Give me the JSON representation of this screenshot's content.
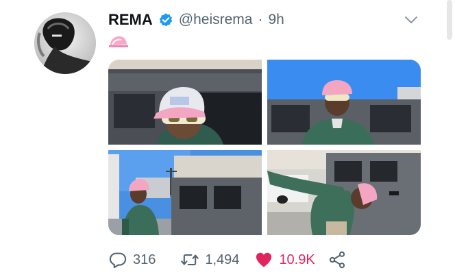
{
  "tweet": {
    "author_name": "REMA",
    "handle": "@heisrema",
    "separator": "·",
    "time": "9h",
    "verified": true,
    "caption_icon": "pink-trucker-cap-emoji",
    "menu_icon": "chevron-down-icon"
  },
  "media": {
    "images": [
      {
        "name": "photo-1",
        "subject": "person in pink trucker cap and yellow goggles leaning on dark jeep"
      },
      {
        "name": "photo-2",
        "subject": "person in pink cap and green hoodie in front of jeep"
      },
      {
        "name": "photo-3",
        "subject": "person in green hoodie standing next to grey jeep"
      },
      {
        "name": "photo-4",
        "subject": "person reaching out by grey jeep"
      }
    ]
  },
  "actions": {
    "reply_count": "316",
    "retweet_count": "1,494",
    "like_count": "10.9K",
    "liked": true
  },
  "colors": {
    "verified": "#1d9bf0",
    "like": "#e0245e",
    "muted": "#536471",
    "text": "#0f1419"
  }
}
